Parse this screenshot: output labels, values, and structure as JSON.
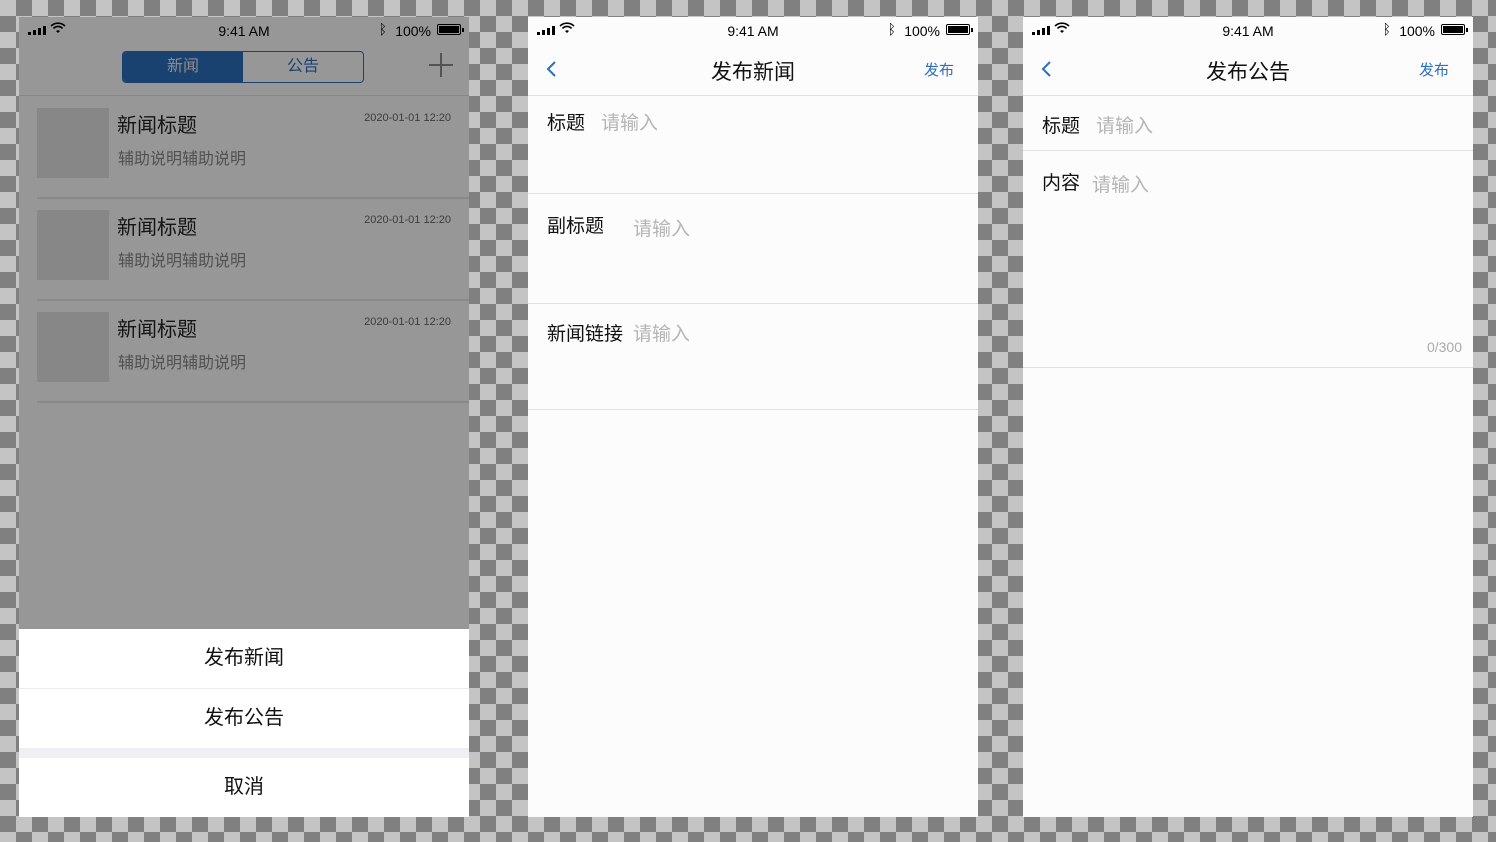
{
  "status_bar": {
    "time": "9:41 AM",
    "battery": "100%",
    "bluetooth": "bluetooth-icon"
  },
  "screen1": {
    "tabs": [
      {
        "label": "新闻",
        "active": true
      },
      {
        "label": "公告",
        "active": false
      }
    ],
    "add_icon": "plus-icon",
    "news_items": [
      {
        "title": "新闻标题",
        "subtitle": "辅助说明辅助说明",
        "date": "2020-01-01  12:20"
      },
      {
        "title": "新闻标题",
        "subtitle": "辅助说明辅助说明",
        "date": "2020-01-01  12:20"
      },
      {
        "title": "新闻标题",
        "subtitle": "辅助说明辅助说明",
        "date": "2020-01-01  12:20"
      }
    ],
    "action_sheet": {
      "option1": "发布新闻",
      "option2": "发布公告",
      "cancel": "取消"
    }
  },
  "screen2": {
    "title": "发布新闻",
    "publish": "发布",
    "fields": [
      {
        "label": "标题",
        "placeholder": "请输入"
      },
      {
        "label": "副标题",
        "placeholder": "请输入"
      },
      {
        "label": "新闻链接",
        "placeholder": "请输入"
      }
    ]
  },
  "screen3": {
    "title": "发布公告",
    "publish": "发布",
    "fields": [
      {
        "label": "标题",
        "placeholder": "请输入"
      },
      {
        "label": "内容",
        "placeholder": "请输入",
        "counter": "0/300"
      }
    ]
  },
  "colors": {
    "accent": "#2b6fbd",
    "placeholder": "#b5b5b5",
    "overlay": "rgba(0,0,0,0.4)"
  }
}
